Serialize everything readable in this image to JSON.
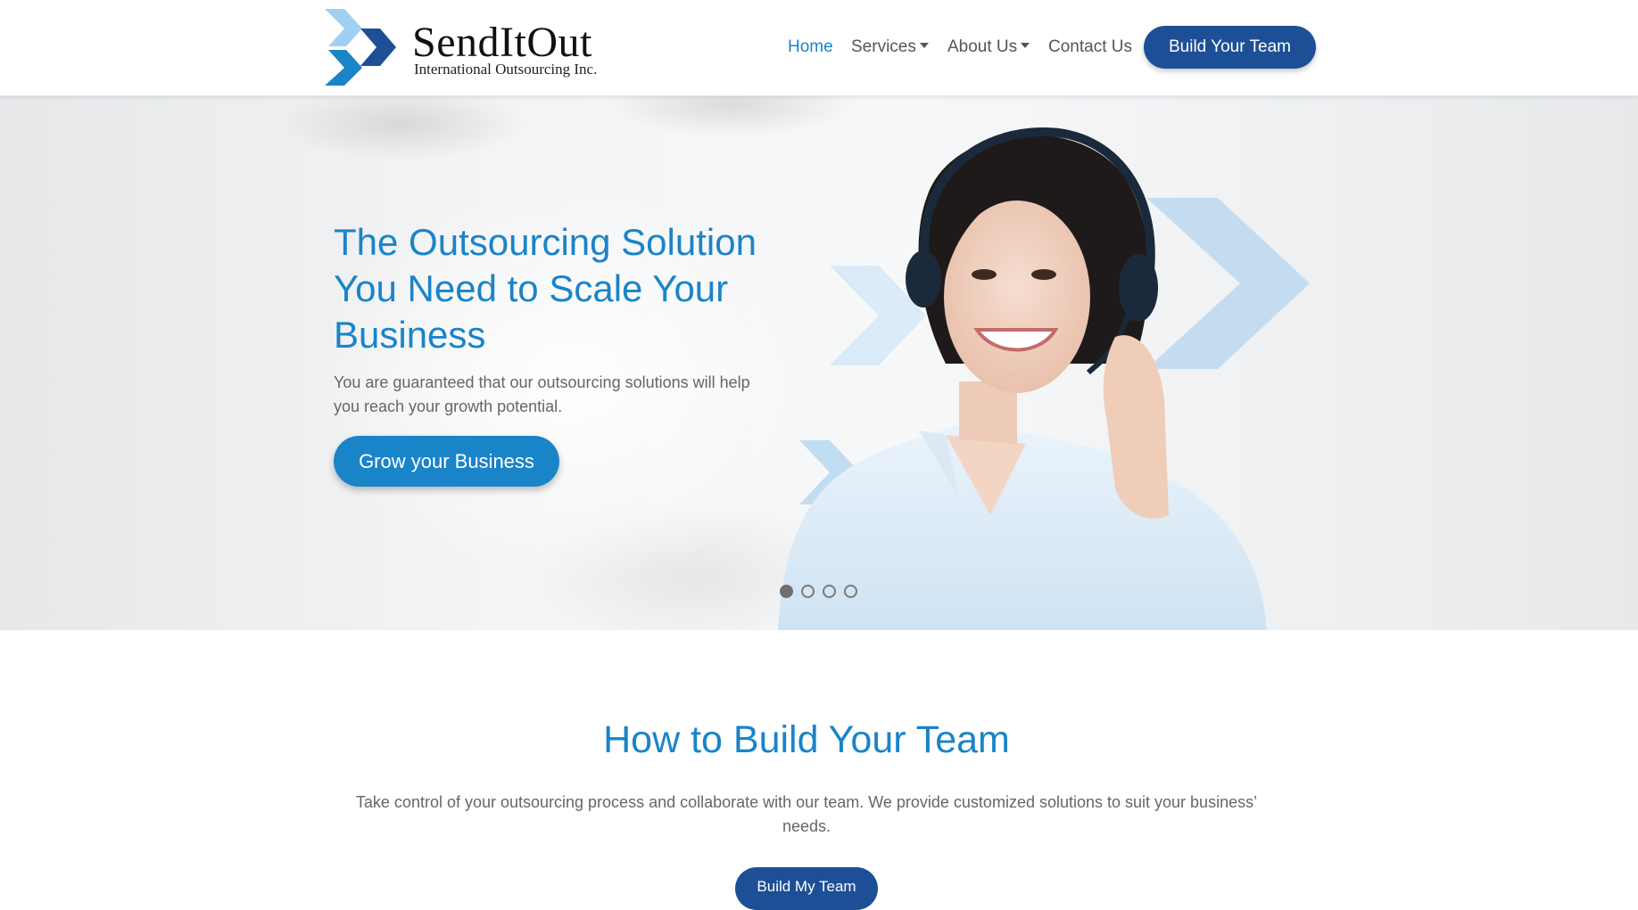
{
  "header": {
    "logo_name": "SendItOut",
    "logo_tagline": "International Outsourcing Inc.",
    "nav": [
      {
        "label": "Home",
        "active": true
      },
      {
        "label": "Services",
        "dropdown": true
      },
      {
        "label": "About Us",
        "dropdown": true
      },
      {
        "label": "Contact Us"
      }
    ],
    "cta_label": "Build Your Team"
  },
  "hero": {
    "title": "The Outsourcing Solution You Need to Scale Your Business",
    "subtitle": "You are guaranteed that our outsourcing solutions will help you reach your growth potential.",
    "button_label": "Grow your Business",
    "slides_total": 4,
    "active_slide": 1
  },
  "section": {
    "title": "How to Build Your Team",
    "text": "Take control of your outsourcing process and collaborate with our team. We provide customized solutions to suit your business’ needs.",
    "button_label": "Build My Team"
  },
  "colors": {
    "accent": "#1a84c8",
    "navy": "#1d4f96",
    "light_blue": "#a9d2ef",
    "text_grey": "#666666"
  },
  "icons": [
    "chevron-logo-icon",
    "caret-down-icon"
  ]
}
